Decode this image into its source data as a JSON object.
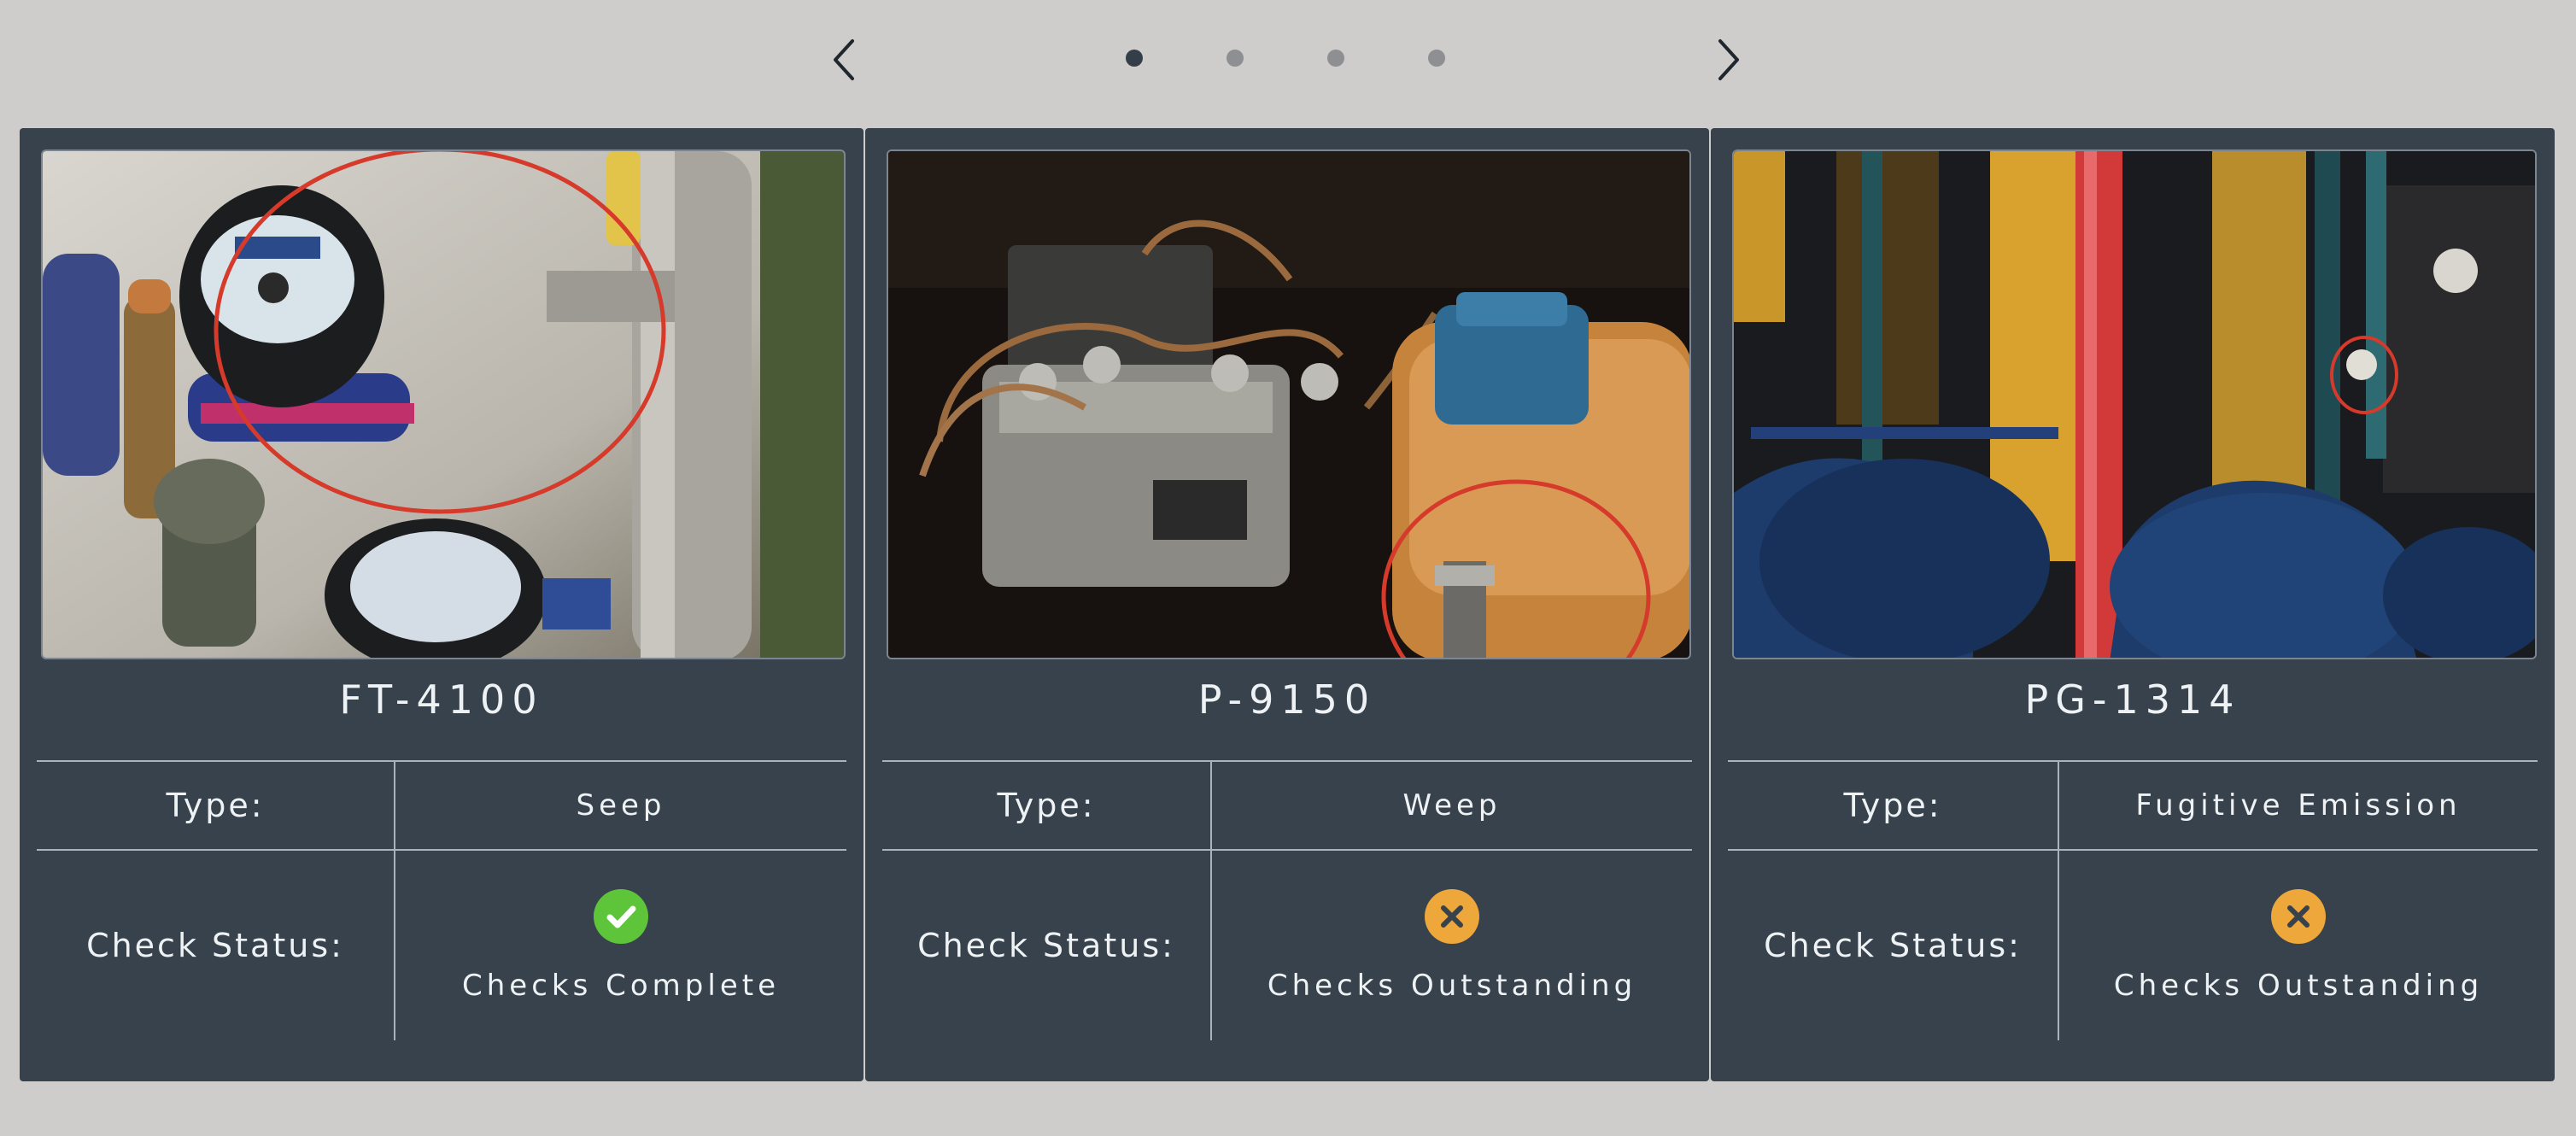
{
  "carousel": {
    "prev_icon": "chevron-left-icon",
    "next_icon": "chevron-right-icon",
    "pages": 4,
    "active_page": 1
  },
  "labels": {
    "type": "Type:",
    "check_status": "Check Status:"
  },
  "colors": {
    "card_bg": "#37424c",
    "complete": "#5ec43a",
    "outstanding": "#eda73a",
    "highlight_circle": "#d63a2a"
  },
  "cards": [
    {
      "tag": "FT-4100",
      "type": "Seep",
      "status": "Checks Complete",
      "status_icon": "check-circle-icon"
    },
    {
      "tag": "P-9150",
      "type": "Weep",
      "status": "Checks Outstanding",
      "status_icon": "x-circle-icon"
    },
    {
      "tag": "PG-1314",
      "type": "Fugitive Emission",
      "status": "Checks Outstanding",
      "status_icon": "x-circle-icon"
    }
  ]
}
